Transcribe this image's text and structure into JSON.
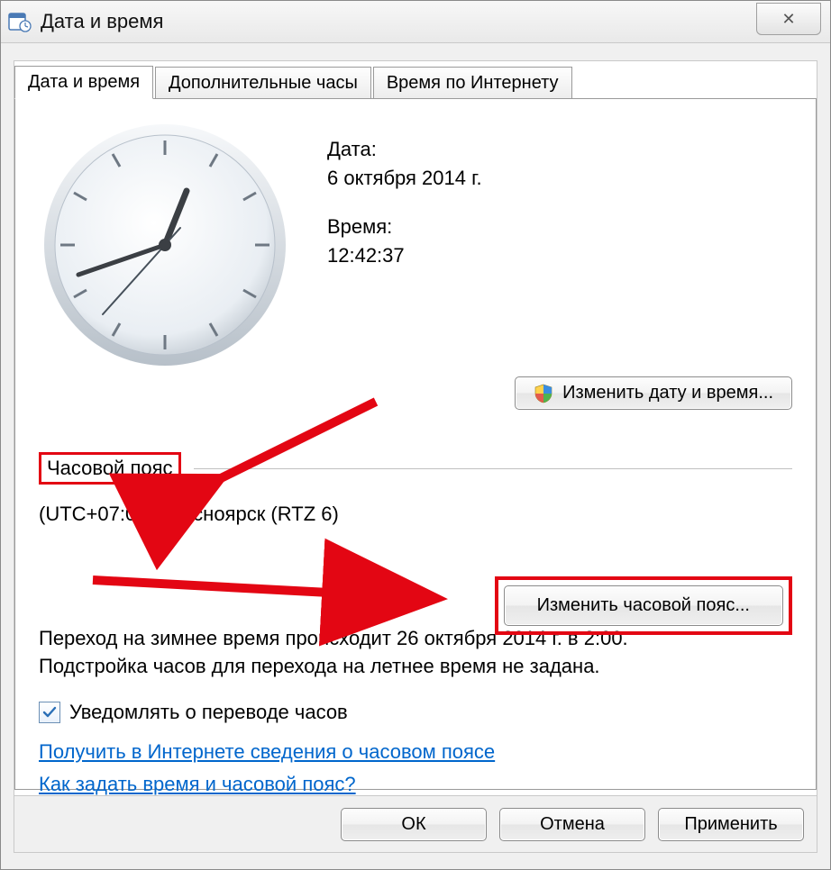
{
  "window": {
    "title": "Дата и время"
  },
  "tabs": [
    {
      "label": "Дата и время",
      "active": true
    },
    {
      "label": "Дополнительные часы",
      "active": false
    },
    {
      "label": "Время по Интернету",
      "active": false
    }
  ],
  "date_section": {
    "date_label": "Дата:",
    "date_value": "6 октября 2014 г.",
    "time_label": "Время:",
    "time_value": "12:42:37"
  },
  "buttons": {
    "change_datetime": "Изменить дату и время...",
    "change_timezone": "Изменить часовой пояс...",
    "ok": "ОК",
    "cancel": "Отмена",
    "apply": "Применить"
  },
  "timezone": {
    "section_label": "Часовой пояс",
    "current": "(UTC+07:00) Красноярск (RTZ 6)"
  },
  "dst": {
    "text_line1": "Переход на зимнее время происходит 26 октября 2014 г. в 2:00.",
    "text_line2": "Подстройка часов для перехода на летнее время не задана.",
    "notify_label": "Уведомлять о переводе часов",
    "notify_checked": true
  },
  "links": {
    "tz_info": "Получить в Интернете сведения о часовом поясе",
    "howto": "Как задать время и часовой пояс?"
  },
  "close_glyph": "✕"
}
